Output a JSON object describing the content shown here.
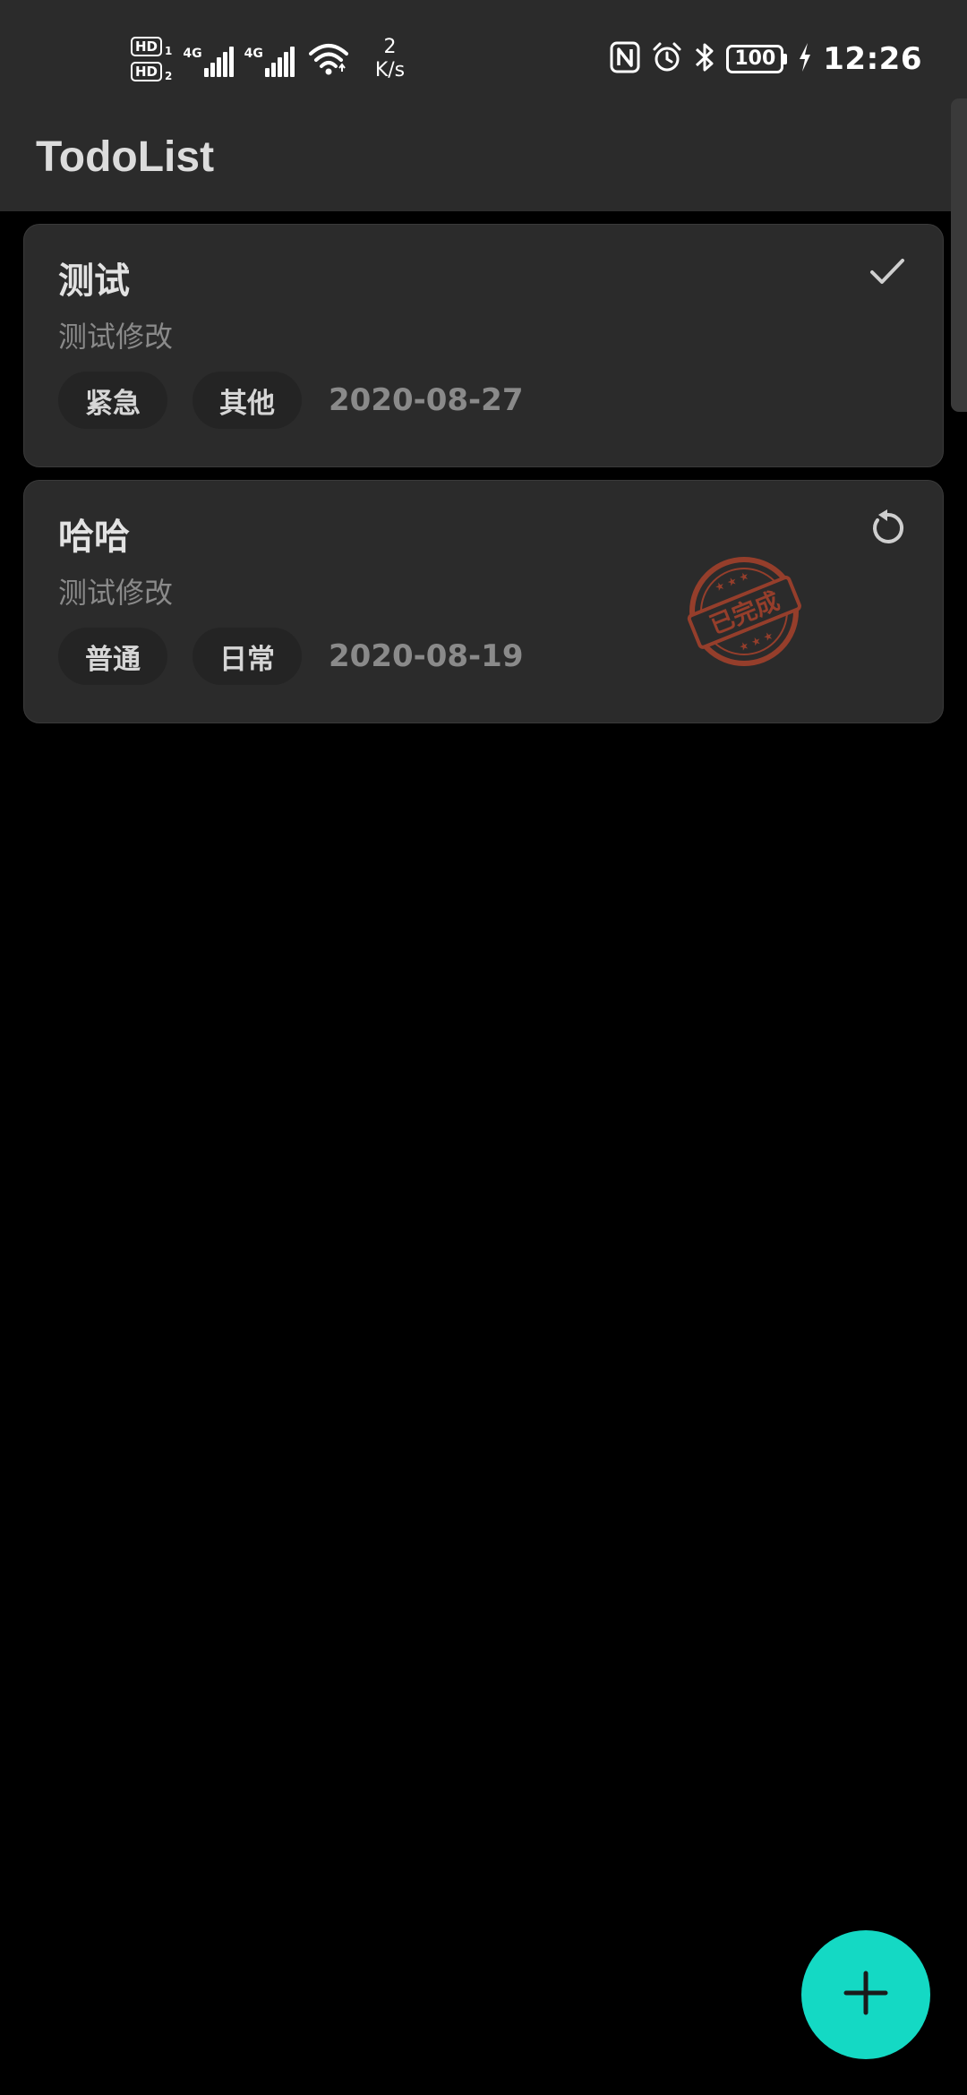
{
  "status_bar": {
    "hd1": "HD",
    "hd1_sub": "1",
    "hd2": "HD",
    "hd2_sub": "2",
    "net1": "4G",
    "net2": "4G",
    "speed_value": "2",
    "speed_unit": "K/s",
    "battery": "100",
    "time": "12:26"
  },
  "app_bar": {
    "title": "TodoList"
  },
  "todos": [
    {
      "title": "测试",
      "description": "测试修改",
      "priority": "紧急",
      "category": "其他",
      "date": "2020-08-27",
      "completed": false,
      "action_icon": "check-icon"
    },
    {
      "title": "哈哈",
      "description": "测试修改",
      "priority": "普通",
      "category": "日常",
      "date": "2020-08-19",
      "completed": true,
      "action_icon": "undo-icon",
      "stamp_text": "已完成"
    }
  ],
  "fab": {
    "icon": "plus-icon"
  },
  "colors": {
    "accent": "#14d9c4",
    "surface": "#2b2b2b",
    "background": "#000000",
    "stamp": "#b0432c"
  }
}
